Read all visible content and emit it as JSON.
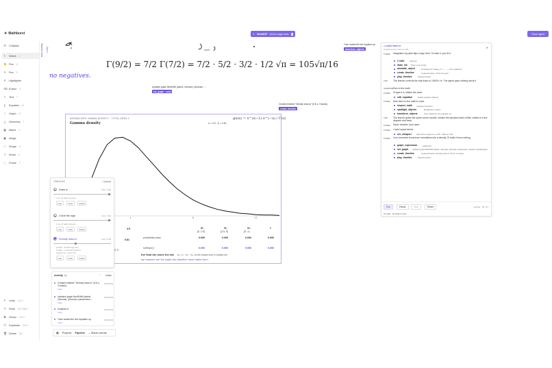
{
  "app": {
    "name": "Mathburst"
  },
  "topbar": {
    "webmcp": "WebMCP",
    "webmcp_detail": "All live page tools",
    "webmcp_close": "x",
    "close_agent": "Close agent"
  },
  "toolbar": {
    "items": [
      {
        "label": "Collapse",
        "key": "",
        "icon": "collapse-icon",
        "glyph": "⊟"
      },
      {
        "label": "Select",
        "key": "V",
        "icon": "cursor-icon",
        "glyph": "↖"
      },
      {
        "label": "Pan",
        "key": "H",
        "icon": "hand-icon",
        "glyph": "✋"
      },
      {
        "label": "Pen",
        "key": "P",
        "icon": "pen-icon",
        "glyph": "✎"
      },
      {
        "label": "Highlighter",
        "key": "",
        "icon": "highlighter-icon",
        "glyph": "✐"
      },
      {
        "label": "Eraser",
        "key": "E",
        "icon": "eraser-icon",
        "glyph": "⌫"
      },
      {
        "label": "Text",
        "key": "T",
        "icon": "text-icon",
        "glyph": "T"
      },
      {
        "label": "Equation",
        "key": "M",
        "icon": "equation-icon",
        "glyph": "∑"
      },
      {
        "label": "Graph",
        "key": "G",
        "icon": "graph-icon",
        "glyph": "⌇"
      },
      {
        "label": "Geometry",
        "key": "J",
        "icon": "geometry-icon",
        "glyph": "△"
      },
      {
        "label": "Matrix",
        "key": "X",
        "icon": "matrix-icon",
        "glyph": "▦"
      },
      {
        "label": "Image",
        "key": "",
        "icon": "image-icon",
        "glyph": "▣"
      },
      {
        "label": "Shape",
        "key": "S",
        "icon": "shape-icon",
        "glyph": "□"
      },
      {
        "label": "Arrow",
        "key": "A",
        "icon": "arrow-icon",
        "glyph": "↗"
      },
      {
        "label": "Frame",
        "key": "F",
        "icon": "frame-icon",
        "glyph": "⬚"
      }
    ],
    "bottom": [
      {
        "label": "Undo",
        "key": "Ctrl Z",
        "icon": "undo-icon",
        "glyph": "↶"
      },
      {
        "label": "Redo",
        "key": "Ctrl Shift Z",
        "icon": "redo-icon",
        "glyph": "↷"
      },
      {
        "label": "Group",
        "key": "Ctrl G",
        "icon": "group-icon",
        "glyph": "⧉"
      },
      {
        "label": "Duplicate",
        "key": "Ctrl D",
        "icon": "duplicate-icon",
        "glyph": "❐"
      },
      {
        "label": "Delete",
        "key": "Del",
        "icon": "trash-icon",
        "glyph": "🗑"
      }
    ]
  },
  "vtabs": {
    "panel_a": "Teacher tools",
    "panel_b": "Agent"
  },
  "canvas": {
    "formula": "Γ(9/2) = 7/2 Γ(7/2) = 7/2 · 5/2 · 3/2 · 1/2 √π = 105√π/16",
    "neg_text": "no negatives.",
    "note_graph": "Updated graph 8ec816fb (labels, xDomain, yDomain, ...",
    "tag_graph": "set_graph · seed",
    "note_tutor": "Tutor scaled the live equation up",
    "tag_transform": "transform_objects",
    "note_timeline": "Created timeline \"Density draw-in\" (5.8 s, 3 tracks)",
    "tag_timeline": "create_timeline"
  },
  "chart_data": {
    "type": "line",
    "caption": "NORMALIZED GAMMA DENSITY · TOTAL AREA 1",
    "title": "Gamma density",
    "params": "α = 4.5 · β = 0.81",
    "equation": "gα(x) = x^(α−1) e^(−x) / Γ(α)",
    "alpha": 4.5,
    "beta": 0.81,
    "x_ticks": [
      "4",
      "8",
      "12"
    ],
    "xlim": [
      0,
      13.5
    ],
    "series": [
      {
        "values_x": [
          0,
          0.5,
          1,
          1.5,
          2,
          2.5,
          3,
          3.5,
          4,
          4.5,
          5,
          5.5,
          6,
          6.5,
          7,
          7.5,
          8,
          8.5,
          9,
          9.5,
          10,
          10.5,
          11,
          11.5,
          12,
          12.5,
          13,
          13.5
        ],
        "values_y": [
          0,
          0.006,
          0.039,
          0.088,
          0.136,
          0.17,
          0.186,
          0.188,
          0.179,
          0.163,
          0.142,
          0.121,
          0.1,
          0.081,
          0.064,
          0.05,
          0.038,
          0.029,
          0.022,
          0.016,
          0.012,
          0.009,
          0.006,
          0.005,
          0.003,
          0.002,
          0.002,
          0.001
        ]
      }
    ],
    "slider_value": "4.5",
    "slider_value2": "0.81"
  },
  "prob_table": {
    "headers": [
      {
        "sym": "W₁",
        "range": "[0, 2.5]"
      },
      {
        "sym": "W₂",
        "range": "[2.5, 5]"
      },
      {
        "sym": "W₃",
        "range": "[5, ∞)"
      },
      {
        "sym": "Σ",
        "range": ""
      }
    ],
    "row1_label": "probability mass",
    "row1": [
      "0.000",
      "0.000",
      "0.000",
      "0.000"
    ],
    "row2_label": "softmax(·)",
    "row2": [
      "0.000",
      "0.000",
      "0.000",
      "0.000"
    ],
    "left_fragment": ".5, 5",
    "tail_note": "the final bin owns the tail",
    "tail_formula": "w₃ = 1 − w₁ − w₂, so the masses sum to exactly one.",
    "tail_note2": "top masses are the logits the attention head starts from."
  },
  "timeline": {
    "header": "TIMELINES",
    "status": "1 playing",
    "items": [
      {
        "name": "Draw in",
        "time": "5.8s / 5.8s",
        "code": "ink.drawProgress",
        "knob": 0.98
      },
      {
        "name": "Circle the sign",
        "time": "1.2s / 1.8s",
        "code": "ink.drawProgress",
        "knob": 0.98
      },
      {
        "name": "Density draw-in",
        "time": "2.2s / 5.8s",
        "code": "graph.drawProgress\ngraph.visualIntegral\nequation.opacity",
        "knob": 0.38
      }
    ],
    "btn_loop": "loop",
    "btn_reset": "reset",
    "btn_delete": "delete"
  },
  "activity": {
    "title": "Activity",
    "count": "10",
    "undo": "Undo",
    "items": [
      {
        "text": "Created timeline \"Density draw-in\" (5.8 s, 3 tracks)",
        "who": "Tutor",
        "time": "05:06 PM"
      },
      {
        "text": "Updated graph 8ec816fb (labels, xDomain, yDomain, parameters,...",
        "who": "Tutor",
        "time": "05:06 PM"
      },
      {
        "text": "Graphed 5",
        "who": "Tutor",
        "time": "05:06 PM"
      },
      {
        "text": "Tutor scaled the live equation up",
        "who": "Tutor",
        "time": "05:06 PM"
      }
    ]
  },
  "bottombar": {
    "projects": "Projects",
    "pipeline": "Pipeline",
    "canvas": "Blank canvas"
  },
  "agent": {
    "header": "AGENT REPLAY",
    "subheader": "scripted events, real tool calls",
    "close": "✕",
    "entries": [
      {
        "role": "TUTOR",
        "text": "Integration by parts flips a sign here. I'll mark it, you fix it."
      },
      {
        "role": "",
        "tool": "2 calls",
        "desc": "Ungroup"
      },
      {
        "role": "",
        "tool": "draw_ink",
        "desc": "Drew 1 pen stroke"
      },
      {
        "role": "",
        "tool": "annotate_object",
        "desc": "Annotated ink 'replay_ic' \"+ → −\" \"two negatives\""
      },
      {
        "role": "",
        "tool": "create_timeline",
        "desc": "Created timeline \"Circle the sign\""
      },
      {
        "role": "",
        "tool": "play_timeline",
        "desc": "Played timeline"
      },
      {
        "role": "YOU",
        "text": "The learner corrects the ball down to 105/16·√π. The agent pays nothing about it."
      },
      {
        "role": "ASSISTANT",
        "text": "Turn to the math"
      },
      {
        "role": "TUTOR",
        "text": "I'll type it in. Watch the caret."
      },
      {
        "role": "",
        "tool": "edit_equation",
        "desc": "Edited equation (labels)"
      },
      {
        "role": "TUTOR",
        "text": "Now there is live math to read."
      },
      {
        "role": "",
        "tool": "inspect_math",
        "desc": "Inspected equation"
      },
      {
        "role": "",
        "tool": "spotlight_objects",
        "desc": "Spotlighted 1 object"
      },
      {
        "role": "",
        "tool": "transform_objects",
        "desc": "Tutor scaled the live equation up"
      },
      {
        "role": "YOU",
        "text": "The learner grabs the same corner handle, shrinks the equation back a little, rotates it a few degrees and back."
      },
      {
        "role": "TUTOR",
        "text": "Same handles I just used."
      },
      {
        "role": "TUTOR",
        "text": "I need space below."
      },
      {
        "role": "",
        "tool": "set_viewport",
        "desc": "Moved the viewport to (-310, -460) at 1.05×"
      },
      {
        "role": "TUTOR",
        "text": "Your corrected recurrence normalises into a density. I'll build it from nothing."
      },
      {
        "role": "",
        "tool": "graph_expression",
        "desc": "Graphed 5"
      },
      {
        "role": "",
        "tool": "set_graph",
        "desc": "Updated graph 8ec816fb (labels, xDomain, yDomain, parameters, integral, visualIntegral, bindings)"
      },
      {
        "role": "",
        "tool": "create_timeline",
        "desc": "Created timeline \"Density draw-in\" (5.8 s, 3 tracks)"
      },
      {
        "role": "",
        "tool": "play_timeline",
        "desc": "Played timeline"
      }
    ],
    "controls": {
      "run": "Run",
      "pause": "Pause",
      "step": "Step",
      "reset": "Reset",
      "status": "running · 31 / 37"
    },
    "footer": "10 calls · 20 distinct tools"
  }
}
